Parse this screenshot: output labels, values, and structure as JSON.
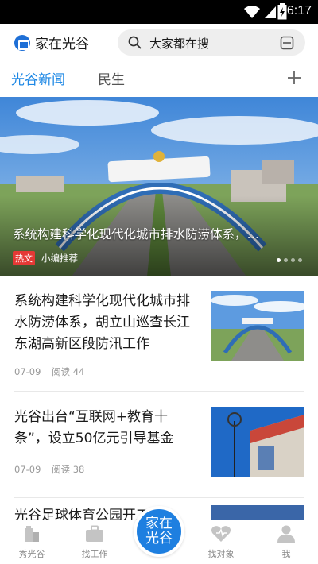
{
  "status_bar": {
    "time": "6:17"
  },
  "header": {
    "logo_text": "家在光谷",
    "search_text": "大家都在搜",
    "search_icon": "search-icon",
    "scan_icon": "scan-icon"
  },
  "tabs": [
    {
      "label": "光谷新闻",
      "active": true
    },
    {
      "label": "民生",
      "active": false
    }
  ],
  "hero": {
    "title": "系统构建科学化现代化城市排水防涝体系，…",
    "tag": "热文",
    "source": "小编推荐",
    "slides": 4,
    "active_slide": 1
  },
  "news": [
    {
      "title": "系统构建科学化现代化城市排水防涝体系，胡立山巡查长江东湖高新区段防汛工作",
      "date": "07-09",
      "reads": "阅读 44"
    },
    {
      "title": "光谷出台“互联网+教育十条”，设立50亿元引导基金",
      "date": "07-09",
      "reads": "阅读 38"
    },
    {
      "title": "光谷足球体育公园开工计",
      "date": "",
      "reads": ""
    }
  ],
  "bottom_nav": {
    "items": [
      {
        "label": "秀光谷",
        "icon": "buildings-icon"
      },
      {
        "label": "找工作",
        "icon": "briefcase-icon"
      },
      {
        "label": "找对象",
        "icon": "heart-icon"
      },
      {
        "label": "我",
        "icon": "person-icon"
      }
    ],
    "center_label": "家在光谷"
  },
  "colors": {
    "accent": "#1e88e5",
    "hot_tag": "#e53935",
    "center_button": "#1e7fe0"
  }
}
